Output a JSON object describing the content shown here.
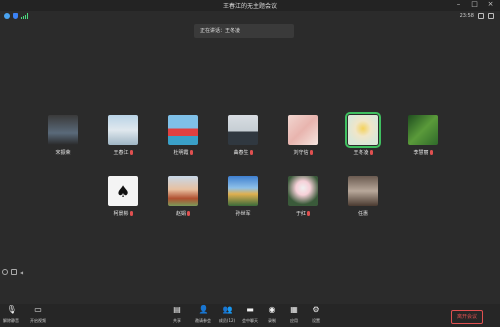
{
  "window": {
    "title": "王春江的无主题会议",
    "clock": "23:58"
  },
  "banner": {
    "speaking": "正在讲话：王冬凌"
  },
  "participants": [
    {
      "name": "宋振荣",
      "muted": false
    },
    {
      "name": "王春江",
      "muted": true
    },
    {
      "name": "杜明霞",
      "muted": true
    },
    {
      "name": "曲春生",
      "muted": true
    },
    {
      "name": "刘守信",
      "muted": true
    },
    {
      "name": "王冬凌",
      "muted": true,
      "active": true
    },
    {
      "name": "李慧丽",
      "muted": true
    },
    {
      "name": "柯景彬",
      "muted": true
    },
    {
      "name": "赵娟",
      "muted": true
    },
    {
      "name": "孙世军",
      "muted": false
    },
    {
      "name": "于红",
      "muted": true
    },
    {
      "name": "任惠",
      "muted": false
    }
  ],
  "toolbar": {
    "left": [
      {
        "label": "解除静音",
        "icon": "mic-icon"
      },
      {
        "label": "开启视频",
        "icon": "camera-icon"
      }
    ],
    "center": [
      {
        "label": "共享",
        "icon": "share-icon"
      },
      {
        "label": "邀请参会",
        "icon": "invite-icon"
      },
      {
        "label": "成员(12)",
        "icon": "members-icon"
      },
      {
        "label": "会中聊天",
        "icon": "chat-icon"
      },
      {
        "label": "录制",
        "icon": "record-icon"
      },
      {
        "label": "应用",
        "icon": "apps-icon"
      },
      {
        "label": "设置",
        "icon": "settings-icon"
      }
    ],
    "leave_label": "离开会议"
  },
  "colors": {
    "accent_active": "#3fbf60",
    "danger": "#e05050",
    "background": "#2b2b2b"
  }
}
